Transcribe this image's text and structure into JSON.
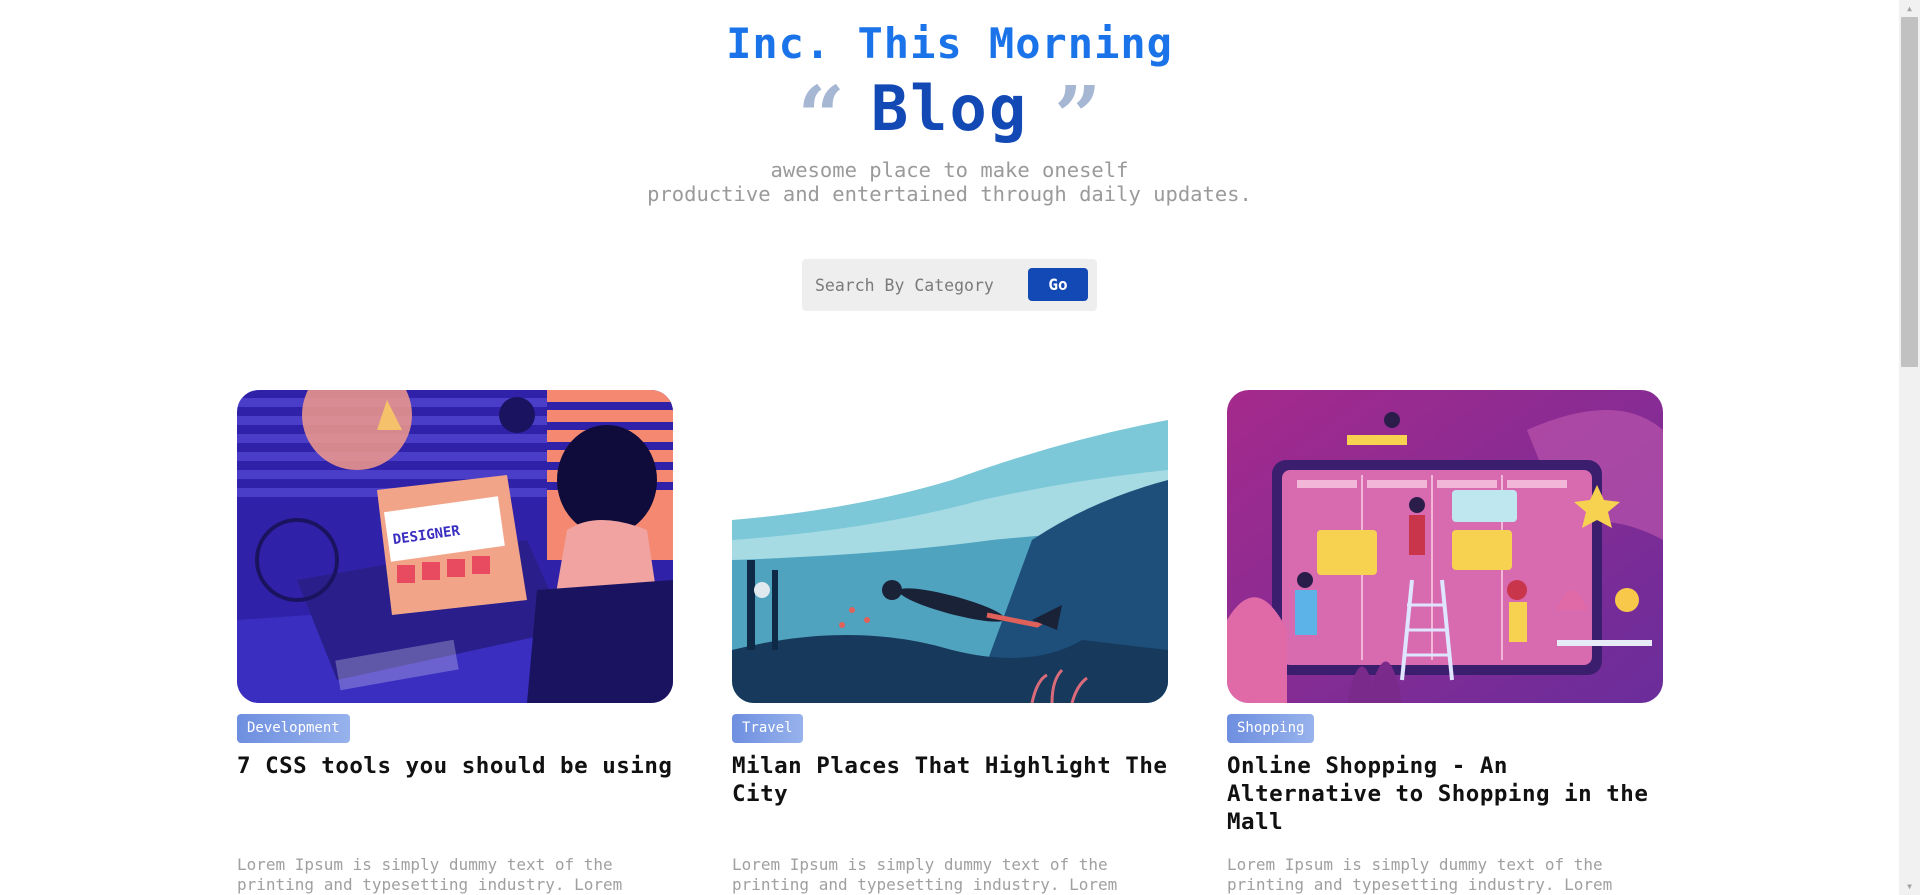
{
  "header": {
    "brand": "Inc. This Morning",
    "open_quote": "“",
    "title": "Blog",
    "close_quote": "”",
    "tagline_line1": "awesome place to make oneself",
    "tagline_line2": "productive and entertained through daily updates."
  },
  "search": {
    "placeholder": "Search By Category",
    "button_label": "Go"
  },
  "posts": [
    {
      "category": "Development",
      "title": "7 CSS tools you should be using",
      "excerpt": "Lorem Ipsum is simply dummy text of the printing and typesetting industry. Lorem",
      "image": "designer-desk-illustration"
    },
    {
      "category": "Travel",
      "title": "Milan Places That Highlight The City",
      "excerpt": "Lorem Ipsum is simply dummy text of the printing and typesetting industry. Lorem",
      "image": "scuba-diver-illustration"
    },
    {
      "category": "Shopping",
      "title": "Online Shopping - An Alternative to Shopping in the Mall",
      "excerpt": "Lorem Ipsum is simply dummy text of the printing and typesetting industry. Lorem",
      "image": "online-shopping-board-illustration"
    }
  ],
  "colors": {
    "brand": "#1a73e8",
    "title": "#1349b4",
    "accent_button": "#1349b4",
    "badge": "#7d9be6",
    "muted_text": "#9a9a9a"
  }
}
